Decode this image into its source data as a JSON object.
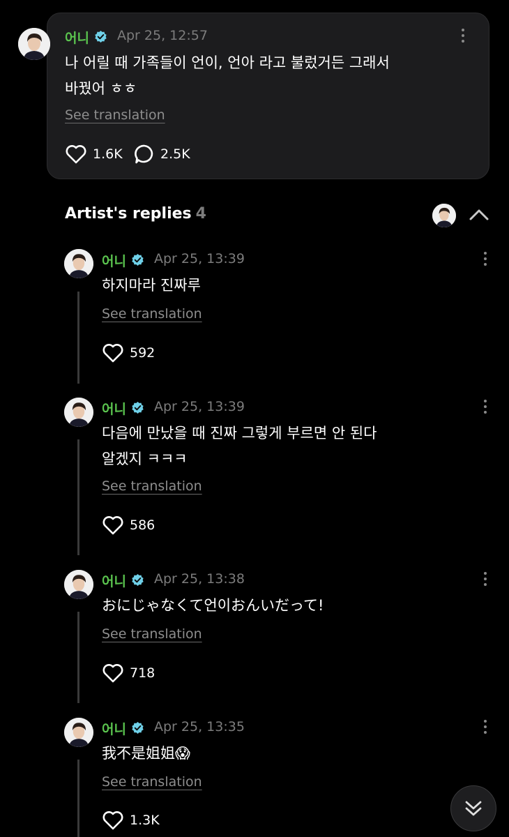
{
  "colors": {
    "background": "#000000",
    "card": "#1c1c1e",
    "author_green": "#5bc54f",
    "verified_blue": "#6fd0e8",
    "muted": "#7c7c7c"
  },
  "post": {
    "author": "어니",
    "time": "Apr 25, 12:57",
    "text": "나 어릴 때 가족들이 언이, 언아 라고 불렀거든 그래서\n바꿨어 ㅎㅎ",
    "see_translation": "See translation",
    "likes": "1.6K",
    "comments": "2.5K",
    "icons": [
      "heart-icon",
      "comment-icon",
      "more-icon",
      "verified-icon"
    ]
  },
  "replies_section": {
    "title": "Artist's replies",
    "count": "4",
    "icons": [
      "chevron-up-icon"
    ]
  },
  "replies": [
    {
      "author": "어니",
      "time": "Apr 25, 13:39",
      "text": "하지마라 진짜루",
      "see_translation": "See translation",
      "likes": "592"
    },
    {
      "author": "어니",
      "time": "Apr 25, 13:39",
      "text": "다음에 만났을 때 진짜 그렇게 부르면 안 된다\n알겠지 ㅋㅋㅋ",
      "see_translation": "See translation",
      "likes": "586"
    },
    {
      "author": "어니",
      "time": "Apr 25, 13:38",
      "text": "おにじゃなくて언이おんいだって!",
      "see_translation": "See translation",
      "likes": "718"
    },
    {
      "author": "어니",
      "time": "Apr 25, 13:35",
      "text": "我不是姐姐😱",
      "see_translation": "See translation",
      "likes": "1.3K"
    }
  ],
  "scroll_button": {
    "icon": "double-chevron-down-icon"
  }
}
